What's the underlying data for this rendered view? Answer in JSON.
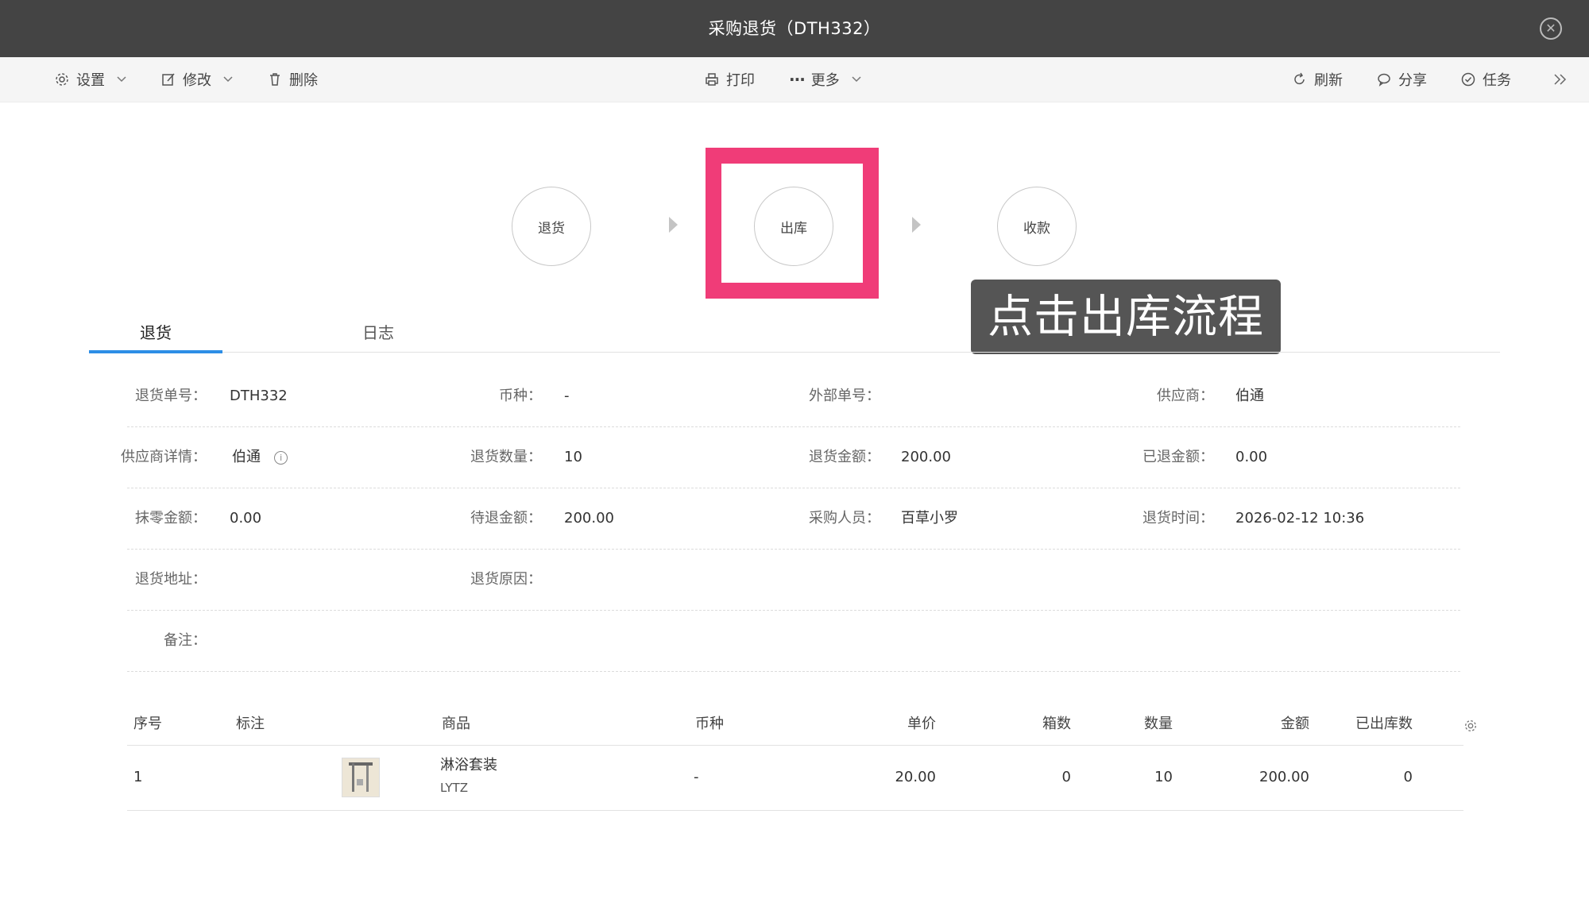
{
  "window": {
    "title": "采购退货（DTH332）"
  },
  "toolbar": {
    "settings": "设置",
    "edit": "修改",
    "delete": "删除",
    "print": "打印",
    "more": "更多",
    "refresh": "刷新",
    "share": "分享",
    "task": "任务"
  },
  "flow": {
    "steps": [
      "退货",
      "出库",
      "收款"
    ],
    "highlighted_step": "出库",
    "highlight_color": "#f03c78"
  },
  "annotation": "点击出库流程",
  "tabs": [
    {
      "label": "退货",
      "active": true
    },
    {
      "label": "日志",
      "active": false
    }
  ],
  "form": {
    "return_no_label": "退货单号：",
    "return_no": "DTH332",
    "currency_label": "币种：",
    "currency": "-",
    "external_no_label": "外部单号：",
    "external_no": "",
    "supplier_label": "供应商：",
    "supplier": "伯通",
    "supplier_detail_label": "供应商详情：",
    "supplier_detail": "伯通",
    "return_qty_label": "退货数量：",
    "return_qty": "10",
    "return_amount_label": "退货金额：",
    "return_amount": "200.00",
    "refunded_label": "已退金额：",
    "refunded": "0.00",
    "rounding_label": "抹零金额：",
    "rounding": "0.00",
    "pending_refund_label": "待退金额：",
    "pending_refund": "200.00",
    "buyer_label": "采购人员：",
    "buyer": "百草小罗",
    "return_time_label": "退货时间：",
    "return_time": "2026-02-12 10:36",
    "address_label": "退货地址：",
    "address": "",
    "reason_label": "退货原因：",
    "reason": "",
    "note_label": "备注：",
    "note": ""
  },
  "table": {
    "headers": {
      "index": "序号",
      "mark": "标注",
      "product": "商品",
      "currency": "币种",
      "unit_price": "单价",
      "boxes": "箱数",
      "qty": "数量",
      "amount": "金额",
      "out_qty": "已出库数"
    },
    "rows": [
      {
        "index": "1",
        "mark": "",
        "product_name": "淋浴套装",
        "product_code": "LYTZ",
        "currency": "-",
        "unit_price": "20.00",
        "boxes": "0",
        "qty": "10",
        "amount": "200.00",
        "out_qty": "0"
      }
    ]
  }
}
